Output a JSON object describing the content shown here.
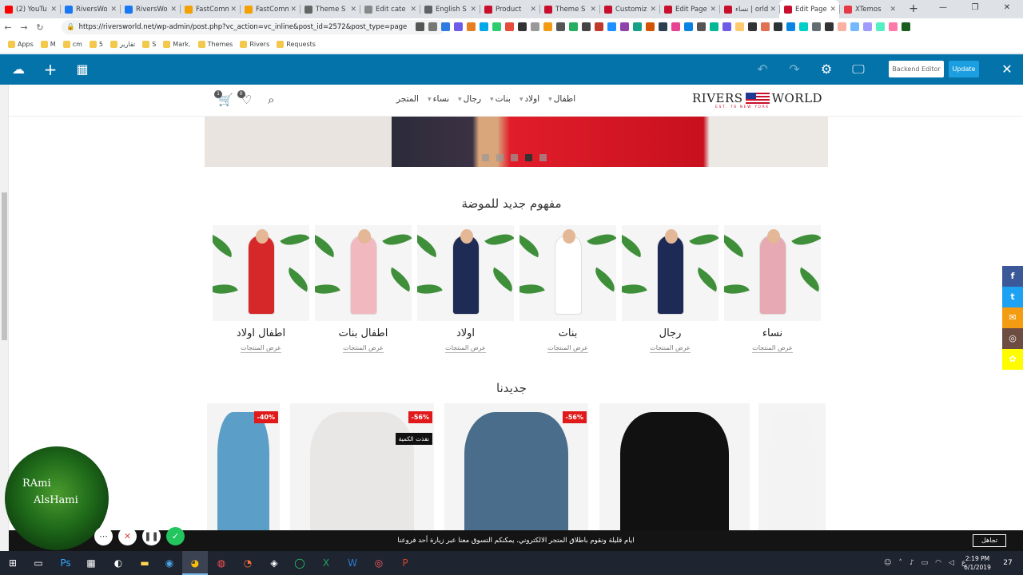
{
  "browser": {
    "tabs": [
      {
        "label": "(2) YouTu",
        "color": "#ff0000"
      },
      {
        "label": "RiversWo",
        "color": "#1877f2"
      },
      {
        "label": "RiversWo",
        "color": "#1877f2"
      },
      {
        "label": "FastComm",
        "color": "#f4a000"
      },
      {
        "label": "FastComm",
        "color": "#f4a000"
      },
      {
        "label": "Theme S",
        "color": "#666666"
      },
      {
        "label": "Edit cate",
        "color": "#888888"
      },
      {
        "label": "English S",
        "color": "#5f6368"
      },
      {
        "label": "Product",
        "color": "#c8102e"
      },
      {
        "label": "Theme S",
        "color": "#c8102e"
      },
      {
        "label": "Customiz",
        "color": "#c8102e"
      },
      {
        "label": "Edit Page",
        "color": "#c8102e"
      },
      {
        "label": "نساء | orld",
        "color": "#c8102e"
      },
      {
        "label": "Edit Page",
        "color": "#c8102e",
        "active": true
      },
      {
        "label": "XTemos",
        "color": "#e63946"
      }
    ],
    "new_tab": "+",
    "window_controls": {
      "minimize": "—",
      "restore": "❐",
      "close": "✕"
    },
    "nav": {
      "back": "←",
      "forward": "→",
      "reload": "↻"
    },
    "url": "https://riversworld.net/wp-admin/post.php?vc_action=vc_inline&post_id=2572&post_type=page",
    "bookmarks": [
      "Apps",
      "M",
      "cm",
      "5",
      "تقارير",
      "S",
      "Mark.",
      "Themes",
      "Rivers",
      "Requests"
    ]
  },
  "editor": {
    "backend_editor_label": "Backend Editor",
    "update_label": "Update"
  },
  "site": {
    "logo_text_left": "RIVERS",
    "logo_text_right": "WORLD",
    "logo_tagline": "EST. 76 NEW YORK",
    "nav": [
      {
        "label": "المتجر",
        "dropdown": false
      },
      {
        "label": "نساء",
        "dropdown": true
      },
      {
        "label": "رجال",
        "dropdown": true
      },
      {
        "label": "بنات",
        "dropdown": true
      },
      {
        "label": "اولاد",
        "dropdown": true
      },
      {
        "label": "اطفال",
        "dropdown": true
      }
    ],
    "cart_count": "1",
    "wishlist_count": "0",
    "slider": {
      "dot_count": 5,
      "active_index": 3
    },
    "categories_title": "مفهوم جديد للموضة",
    "categories": [
      {
        "title": "اطفال اولاد",
        "link": "عرض المنتجات",
        "shirt": "#d62828"
      },
      {
        "title": "اطفال بنات",
        "link": "عرض المنتجات",
        "shirt": "#f2b8c0"
      },
      {
        "title": "اولاد",
        "link": "عرض المنتجات",
        "shirt": "#1d2b55"
      },
      {
        "title": "بنات",
        "link": "عرض المنتجات",
        "shirt": "#ffffff"
      },
      {
        "title": "رجال",
        "link": "عرض المنتجات",
        "shirt": "#1c2a55"
      },
      {
        "title": "نساء",
        "link": "عرض المنتجات",
        "shirt": "#e7a9b3"
      }
    ],
    "new_title": "جديدنا",
    "products": [
      {
        "badge": "40%-",
        "oos": "",
        "color": "#5b9fc8"
      },
      {
        "badge": "56%-",
        "oos": "نفذت الكمية",
        "color": "#e9e6e6"
      },
      {
        "badge": "56%-",
        "oos": "",
        "color": "#4a6d8c"
      },
      {
        "badge": "",
        "oos": "",
        "color": "#111111"
      },
      {
        "badge": "",
        "oos": "",
        "color": "#f3f3f3"
      }
    ],
    "social": [
      {
        "icon": "facebook-icon",
        "glyph": "f",
        "color": "#3b5998"
      },
      {
        "icon": "twitter-icon",
        "glyph": "t",
        "color": "#1da1f2"
      },
      {
        "icon": "email-icon",
        "glyph": "✉",
        "color": "#f39c12"
      },
      {
        "icon": "instagram-icon",
        "glyph": "◎",
        "color": "#6d4c41"
      },
      {
        "icon": "snapchat-icon",
        "glyph": "✿",
        "color": "#fffc00"
      }
    ],
    "notice_text": "ايام قليلة ونقوم باطلاق المتجر الالكتروني. يمكنكم التسوق معنا عبر زيارة أحد فروعنا",
    "notice_button": "تجاهل"
  },
  "overlay": {
    "webcam_name_line1": "RAmi",
    "webcam_name_line2": "AlsHami"
  },
  "taskbar": {
    "time": "2:19 PM",
    "date": "6/1/2019",
    "lang": "ع",
    "notifications": "27"
  }
}
